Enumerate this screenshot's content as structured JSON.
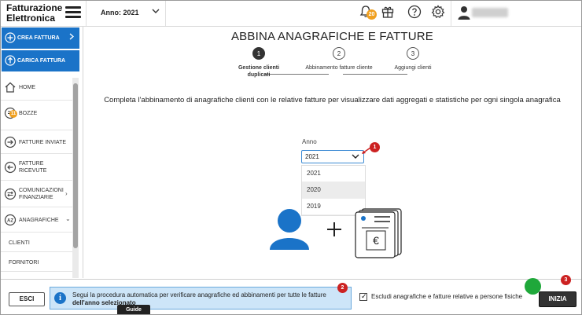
{
  "app": {
    "brand_line1": "Fatturazione",
    "brand_line2": "Elettronica"
  },
  "header": {
    "year_label": "Anno: 2021",
    "notification_count": "20"
  },
  "sidebar": {
    "crea_fattura": "CREA FATTURA",
    "carica_fattura": "CARICA FATTURA",
    "items": [
      {
        "label": "HOME"
      },
      {
        "label": "BOZZE",
        "badge": "11"
      },
      {
        "label": "FATTURE INVIATE"
      },
      {
        "label_line1": "FATTURE",
        "label_line2": "RICEVUTE"
      },
      {
        "label_line1": "COMUNICAZIONI",
        "label_line2": "FINANZIARIE"
      },
      {
        "label": "ANAGRAFICHE",
        "icon_text": "AZ"
      },
      {
        "label": "CLIENTI"
      },
      {
        "label": "FORNITORI"
      }
    ]
  },
  "main": {
    "title": "ABBINA ANAGRAFICHE E FATTURE",
    "steps": [
      {
        "num": "1",
        "label_line1": "Gestione clienti",
        "label_line2": "duplicati"
      },
      {
        "num": "2",
        "label": "Abbinamento fatture cliente"
      },
      {
        "num": "3",
        "label": "Aggiungi clienti"
      }
    ],
    "description": "Completa l'abbinamento di anagrafiche clienti con le relative fatture per visualizzare dati aggregati e statistiche per ogni singola anagrafica",
    "year_field": {
      "label": "Anno",
      "value": "2021",
      "options": [
        "2021",
        "2020",
        "2019"
      ]
    },
    "markers": [
      "1",
      "2",
      "3"
    ]
  },
  "footer": {
    "esci": "ESCI",
    "info_line1": "Segui la procedura automatica per verificare anagrafiche ed abbinamenti per tutte le fatture",
    "info_line2": "dell'anno selezionato",
    "guide": "Guide",
    "checkbox_label": "Escludi anagrafiche e fatture relative a persone fisiche",
    "checkbox_checked": true,
    "inizia": "INIZIA"
  },
  "colors": {
    "accent": "#1a73c8",
    "badge": "#f0a020",
    "marker": "#cc2222",
    "person": "#1a73c8"
  }
}
